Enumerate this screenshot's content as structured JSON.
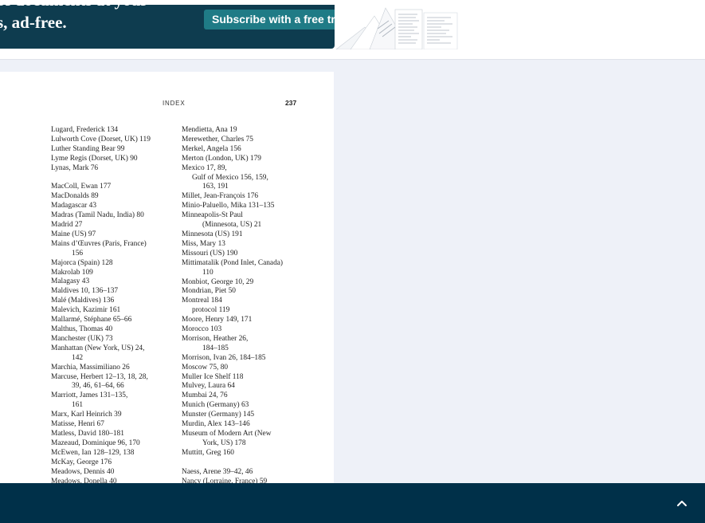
{
  "banner": {
    "headline_line1": "of documents at your",
    "headline_line2": "s, ad-free.",
    "subscribe_label": "Subscribe with a free trial"
  },
  "page": {
    "header": "INDEX",
    "number": "237",
    "left_column": [
      {
        "text": "Lugard, Frederick 134"
      },
      {
        "text": "Lulworth Cove (Dorset, UK) 119"
      },
      {
        "text": "Luther Standing Bear 99"
      },
      {
        "text": "Lyme Regis (Dorset, UK) 90"
      },
      {
        "text": "Lynas, Mark 76"
      },
      {
        "text": "",
        "gap": true
      },
      {
        "text": "MacColl, Ewan 177"
      },
      {
        "text": "MacDonalds 89"
      },
      {
        "text": "Madagascar 43"
      },
      {
        "text": "Madras (Tamil Nadu, India) 80"
      },
      {
        "text": "Madrid 27"
      },
      {
        "text": "Maine (US) 97"
      },
      {
        "text": "Mains d’Œuvres (Paris, France)"
      },
      {
        "text": "156",
        "indent": 1
      },
      {
        "text": "Majorca (Spain) 128"
      },
      {
        "text": "Makrolab 109"
      },
      {
        "text": "Malagasy 43"
      },
      {
        "text": "Maldives 10, 136–137"
      },
      {
        "text": "Malé (Maldives) 136"
      },
      {
        "text": "Malevich, Kazimir 161"
      },
      {
        "text": "Mallarmé, Stéphane 65–66"
      },
      {
        "text": "Malthus, Thomas 40"
      },
      {
        "text": "Manchester (UK) 73"
      },
      {
        "text": "Manhattan (New York, US) 24,"
      },
      {
        "text": "142",
        "indent": 1
      },
      {
        "text": "Marchia, Massimiliano 26"
      },
      {
        "text": "Marcuse, Herbert 12–13, 18, 28,"
      },
      {
        "text": "39, 46, 61–64, 66",
        "indent": 1
      },
      {
        "text": "Marriott, James 131–135,"
      },
      {
        "text": "161",
        "indent": 1
      },
      {
        "text": "Marx, Karl Heinrich 39"
      },
      {
        "text": "Matisse, Henri 67"
      },
      {
        "text": "Matless, David 180–181"
      },
      {
        "text": "Mazeaud, Dominique 96, 170"
      },
      {
        "text": "McEwen, Ian 128–129, 138"
      },
      {
        "text": "McKay, George 176"
      },
      {
        "text": "Meadows, Dennis 40"
      },
      {
        "text": "Meadows, Donella 40"
      }
    ],
    "right_column": [
      {
        "text": "Mendietta, Ana 19"
      },
      {
        "text": "Merewether, Charles 75"
      },
      {
        "text": "Merkel, Angela 156"
      },
      {
        "text": "Merton (London, UK) 179"
      },
      {
        "text": "Mexico 17, 89,"
      },
      {
        "text": "Gulf of Mexico 156, 159,",
        "indent": 2
      },
      {
        "text": "163, 191",
        "indent": 1
      },
      {
        "text": "Millet, Jean-François 176"
      },
      {
        "text": "Minio-Paluello, Mika 131–135"
      },
      {
        "text": "Minneapolis-St Paul"
      },
      {
        "text": "(Minnesota, US) 21",
        "indent": 1
      },
      {
        "text": "Minnesota (US) 191"
      },
      {
        "text": "Miss, Mary 13"
      },
      {
        "text": "Missouri (US) 190"
      },
      {
        "text": "Mittimatalik (Pond Inlet, Canada)"
      },
      {
        "text": "110",
        "indent": 1
      },
      {
        "text": "Monbiot, George 10, 29"
      },
      {
        "text": "Mondrian, Piet 50"
      },
      {
        "text": "Montreal 184"
      },
      {
        "text": "protocol 119",
        "indent": 2
      },
      {
        "text": "Moore, Henry 149, 171"
      },
      {
        "text": "Morocco 103"
      },
      {
        "text": "Morrison, Heather 26,"
      },
      {
        "text": "184–185",
        "indent": 1
      },
      {
        "text": "Morrison, Ivan 26, 184–185"
      },
      {
        "text": "Moscow 75, 80"
      },
      {
        "text": "Muller Ice Shelf 118"
      },
      {
        "text": "Mulvey, Laura 64"
      },
      {
        "text": "Mumbai 24, 76"
      },
      {
        "text": "Munich (Germany) 63"
      },
      {
        "text": "Munster (Germany) 145"
      },
      {
        "text": "Murdin, Alex 143–146"
      },
      {
        "text": "Museum of Modern Art (New"
      },
      {
        "text": "York, US) 178",
        "indent": 1
      },
      {
        "text": "Muttitt, Greg 160"
      },
      {
        "text": "",
        "gap": true
      },
      {
        "text": "Naess, Arene 39–42, 46"
      },
      {
        "text": "Nancy (Lorraine, France) 59"
      }
    ]
  },
  "footer": {
    "scroll_top_icon": "chevron-up-icon"
  },
  "colors": {
    "banner_bg": "#0e3c4f",
    "button_bg": "#1f7b86",
    "footer_bg": "#003049",
    "page_bg": "#eef1f8"
  }
}
